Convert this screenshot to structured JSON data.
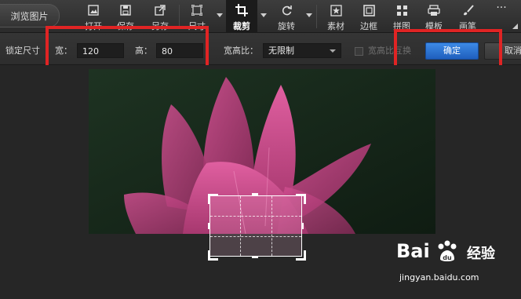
{
  "toolbar": {
    "browse_label": "浏览图片",
    "tools": [
      {
        "label": "打开",
        "icon": "open-image-icon"
      },
      {
        "label": "保存",
        "icon": "save-icon"
      },
      {
        "label": "另存",
        "icon": "save-as-icon"
      },
      {
        "label": "尺寸",
        "icon": "resize-icon"
      },
      {
        "label": "裁剪",
        "icon": "crop-icon",
        "active": true
      },
      {
        "label": "旋转",
        "icon": "rotate-icon"
      },
      {
        "label": "素材",
        "icon": "star-sticker-icon"
      },
      {
        "label": "边框",
        "icon": "frame-icon"
      },
      {
        "label": "拼图",
        "icon": "collage-grid-icon"
      },
      {
        "label": "模板",
        "icon": "template-icon"
      },
      {
        "label": "画笔",
        "icon": "brush-icon"
      }
    ],
    "more_label": "···"
  },
  "crop_options": {
    "lock_size_label": "锁定尺寸",
    "width_label": "宽：",
    "width_value": "120",
    "height_label": "高：",
    "height_value": "80",
    "ratio_label": "宽高比：",
    "ratio_value": "无限制",
    "swap_label": "宽高比互换",
    "confirm_label": "确定",
    "cancel_label": "取消"
  },
  "colors": {
    "accent": "#2a6fd1",
    "highlight": "#e02424",
    "background": "#2a2a2a"
  },
  "watermark": {
    "logo_text": "Bai",
    "logo_text2": "经验",
    "url": "jingyan.baidu.com"
  }
}
